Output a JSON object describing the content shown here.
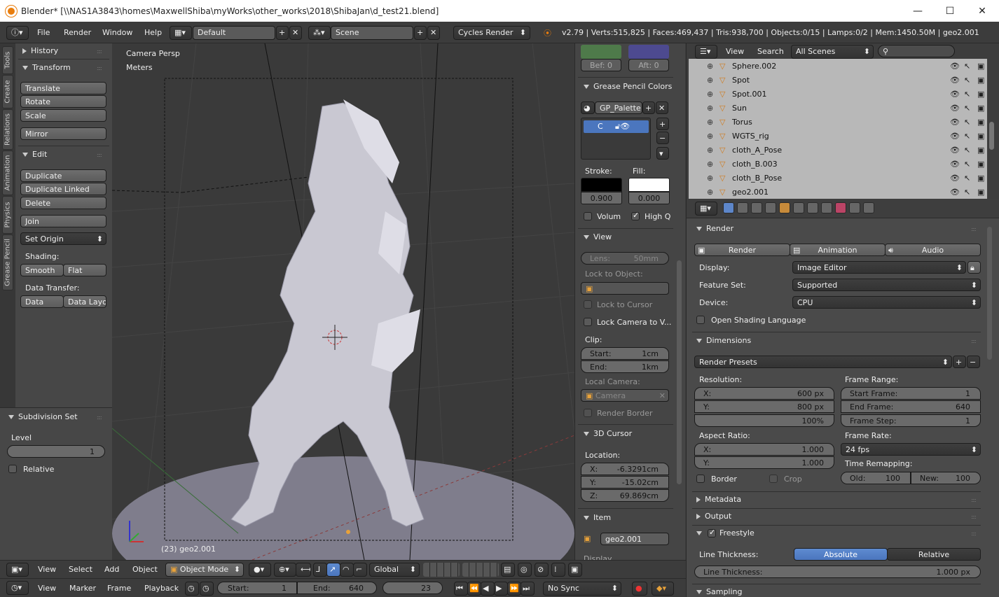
{
  "window": {
    "title": "Blender* [\\\\NAS1A3843\\homes\\MaxwellShiba\\myWorks\\other_works\\2018\\ShibaJan\\d_test21.blend]",
    "minimize": "—",
    "maximize": "☐",
    "close": "✕"
  },
  "topbar": {
    "menus": [
      "File",
      "Render",
      "Window",
      "Help"
    ],
    "layout": "Default",
    "scene": "Scene",
    "engine": "Cycles Render",
    "stats": "v2.79 | Verts:515,825 | Faces:469,437 | Tris:938,700 | Objects:0/15 | Lamps:0/2 | Mem:1450.50M | geo2.001"
  },
  "tool_tabs": [
    "Tools",
    "Create",
    "Relations",
    "Animation",
    "Physics",
    "Grease Pencil"
  ],
  "toolshelf": {
    "history": "History",
    "transform": "Transform",
    "translate": "Translate",
    "rotate": "Rotate",
    "scale": "Scale",
    "mirror": "Mirror",
    "edit": "Edit",
    "duplicate": "Duplicate",
    "duplicate_linked": "Duplicate Linked",
    "delete": "Delete",
    "join": "Join",
    "set_origin": "Set Origin",
    "shading": "Shading:",
    "smooth": "Smooth",
    "flat": "Flat",
    "data_transfer": "Data Transfer:",
    "data": "Data",
    "data_layo": "Data Layo"
  },
  "operator": {
    "title": "Subdivision Set",
    "level_label": "Level",
    "level": "1",
    "relative": "Relative"
  },
  "viewport": {
    "view_name": "Camera Persp",
    "units": "Meters",
    "object_info": "(23) geo2.001"
  },
  "npanel": {
    "bef": "Bef: 0",
    "aft": "Aft: 0",
    "gp_colors": "Grease Pencil Colors",
    "gp_palette": "GP_Palette",
    "gp_color": "C",
    "stroke": "Stroke:",
    "fill": "Fill:",
    "stroke_val": "0.900",
    "fill_val": "0.000",
    "volum": "Volum",
    "highq": "High Q",
    "view": "View",
    "lens": "Lens:",
    "lens_val": "50mm",
    "lock_obj": "Lock to Object:",
    "lock_cursor": "Lock to Cursor",
    "lock_camera": "Lock Camera to V...",
    "clip": "Clip:",
    "start": "Start:",
    "start_val": "1cm",
    "end": "End:",
    "end_val": "1km",
    "local_cam": "Local Camera:",
    "camera": "Camera",
    "render_border": "Render Border",
    "cursor3d": "3D Cursor",
    "location": "Location:",
    "x": "X:",
    "x_val": "-6.3291cm",
    "y": "Y:",
    "y_val": "-15.02cm",
    "z": "Z:",
    "z_val": "69.869cm",
    "item": "Item",
    "item_name": "geo2.001",
    "display": "Display"
  },
  "outliner": {
    "view": "View",
    "search": "Search",
    "scenes": "All Scenes",
    "rows": [
      {
        "name": "Sphere.002"
      },
      {
        "name": "Spot"
      },
      {
        "name": "Spot.001"
      },
      {
        "name": "Sun"
      },
      {
        "name": "Torus"
      },
      {
        "name": "WGTS_rig"
      },
      {
        "name": "cloth_A_Pose"
      },
      {
        "name": "cloth_B.003"
      },
      {
        "name": "cloth_B_Pose"
      },
      {
        "name": "geo2.001"
      }
    ]
  },
  "properties": {
    "render": "Render",
    "render_btn": "Render",
    "animation": "Animation",
    "audio": "Audio",
    "display": "Display:",
    "display_val": "Image Editor",
    "feature_set": "Feature Set:",
    "feature_val": "Supported",
    "device": "Device:",
    "device_val": "CPU",
    "osl": "Open Shading Language",
    "dimensions": "Dimensions",
    "presets": "Render Presets",
    "resolution": "Resolution:",
    "res_x": "X:",
    "res_x_val": "600 px",
    "res_y": "Y:",
    "res_y_val": "800 px",
    "res_pct": "100%",
    "frame_range": "Frame Range:",
    "start_frame": "Start Frame:",
    "start_frame_val": "1",
    "end_frame": "End Frame:",
    "end_frame_val": "640",
    "frame_step": "Frame Step:",
    "frame_step_val": "1",
    "aspect": "Aspect Ratio:",
    "asp_x": "X:",
    "asp_x_val": "1.000",
    "asp_y": "Y:",
    "asp_y_val": "1.000",
    "frame_rate": "Frame Rate:",
    "fps": "24 fps",
    "border": "Border",
    "crop": "Crop",
    "time_remap": "Time Remapping:",
    "old": "Old:",
    "old_val": "100",
    "new": "New:",
    "new_val": "100",
    "metadata": "Metadata",
    "output": "Output",
    "freestyle": "Freestyle",
    "line_thickness": "Line Thickness:",
    "absolute": "Absolute",
    "relative": "Relative",
    "line_thickness_fld": "Line Thickness:",
    "line_thickness_val": "1.000 px",
    "sampling": "Sampling"
  },
  "view3d_header": {
    "view": "View",
    "select": "Select",
    "add": "Add",
    "object": "Object",
    "mode": "Object Mode",
    "orientation": "Global"
  },
  "timeline": {
    "view": "View",
    "marker": "Marker",
    "frame": "Frame",
    "playback": "Playback",
    "start": "Start:",
    "start_val": "1",
    "end": "End:",
    "end_val": "640",
    "current": "23",
    "sync": "No Sync"
  }
}
